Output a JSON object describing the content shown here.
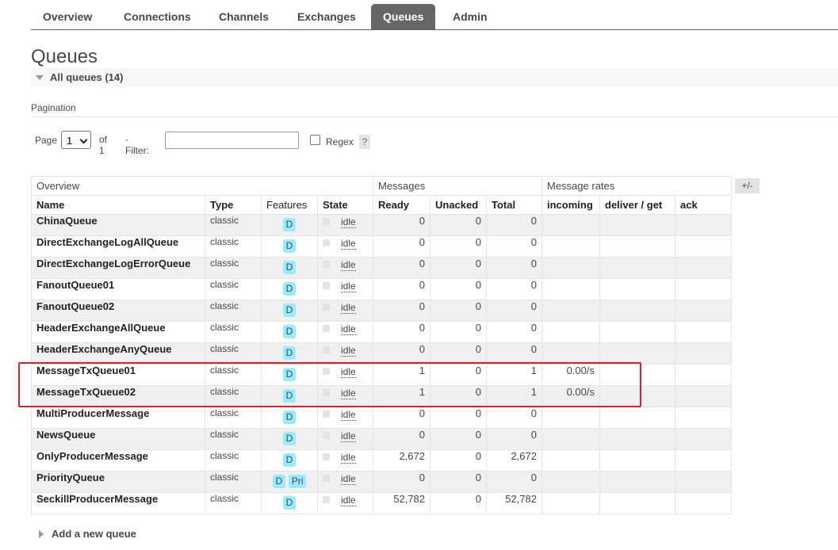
{
  "tabs": [
    "Overview",
    "Connections",
    "Channels",
    "Exchanges",
    "Queues",
    "Admin"
  ],
  "active_tab": "Queues",
  "page_title": "Queues",
  "section": {
    "label": "All queues (14)"
  },
  "pagination": {
    "label": "Pagination",
    "page_label": "Page",
    "page_value": "1",
    "of_label": "of 1",
    "filter_label": "- Filter:",
    "filter_value": "",
    "regex_label": "Regex",
    "help": "?"
  },
  "table": {
    "groups": [
      "Overview",
      "Messages",
      "Message rates"
    ],
    "columns": [
      "Name",
      "Type",
      "Features",
      "State",
      "Ready",
      "Unacked",
      "Total",
      "incoming",
      "deliver / get",
      "ack"
    ],
    "toggle": "+/-",
    "rows": [
      {
        "name": "ChinaQueue",
        "type": "classic",
        "features": [
          "D"
        ],
        "state": "idle",
        "ready": "0",
        "unacked": "0",
        "total": "0",
        "incoming": "",
        "deliver": "",
        "ack": ""
      },
      {
        "name": "DirectExchangeLogAllQueue",
        "type": "classic",
        "features": [
          "D"
        ],
        "state": "idle",
        "ready": "0",
        "unacked": "0",
        "total": "0",
        "incoming": "",
        "deliver": "",
        "ack": ""
      },
      {
        "name": "DirectExchangeLogErrorQueue",
        "type": "classic",
        "features": [
          "D"
        ],
        "state": "idle",
        "ready": "0",
        "unacked": "0",
        "total": "0",
        "incoming": "",
        "deliver": "",
        "ack": ""
      },
      {
        "name": "FanoutQueue01",
        "type": "classic",
        "features": [
          "D"
        ],
        "state": "idle",
        "ready": "0",
        "unacked": "0",
        "total": "0",
        "incoming": "",
        "deliver": "",
        "ack": ""
      },
      {
        "name": "FanoutQueue02",
        "type": "classic",
        "features": [
          "D"
        ],
        "state": "idle",
        "ready": "0",
        "unacked": "0",
        "total": "0",
        "incoming": "",
        "deliver": "",
        "ack": ""
      },
      {
        "name": "HeaderExchangeAllQueue",
        "type": "classic",
        "features": [
          "D"
        ],
        "state": "idle",
        "ready": "0",
        "unacked": "0",
        "total": "0",
        "incoming": "",
        "deliver": "",
        "ack": ""
      },
      {
        "name": "HeaderExchangeAnyQueue",
        "type": "classic",
        "features": [
          "D"
        ],
        "state": "idle",
        "ready": "0",
        "unacked": "0",
        "total": "0",
        "incoming": "",
        "deliver": "",
        "ack": ""
      },
      {
        "name": "MessageTxQueue01",
        "type": "classic",
        "features": [
          "D"
        ],
        "state": "idle",
        "ready": "1",
        "unacked": "0",
        "total": "1",
        "incoming": "0.00/s",
        "deliver": "",
        "ack": ""
      },
      {
        "name": "MessageTxQueue02",
        "type": "classic",
        "features": [
          "D"
        ],
        "state": "idle",
        "ready": "1",
        "unacked": "0",
        "total": "1",
        "incoming": "0.00/s",
        "deliver": "",
        "ack": ""
      },
      {
        "name": "MultiProducerMessage",
        "type": "classic",
        "features": [
          "D"
        ],
        "state": "idle",
        "ready": "0",
        "unacked": "0",
        "total": "0",
        "incoming": "",
        "deliver": "",
        "ack": ""
      },
      {
        "name": "NewsQueue",
        "type": "classic",
        "features": [
          "D"
        ],
        "state": "idle",
        "ready": "0",
        "unacked": "0",
        "total": "0",
        "incoming": "",
        "deliver": "",
        "ack": ""
      },
      {
        "name": "OnlyProducerMessage",
        "type": "classic",
        "features": [
          "D"
        ],
        "state": "idle",
        "ready": "2,672",
        "unacked": "0",
        "total": "2,672",
        "incoming": "",
        "deliver": "",
        "ack": ""
      },
      {
        "name": "PriorityQueue",
        "type": "classic",
        "features": [
          "D",
          "Pri"
        ],
        "state": "idle",
        "ready": "0",
        "unacked": "0",
        "total": "0",
        "incoming": "",
        "deliver": "",
        "ack": ""
      },
      {
        "name": "SeckillProducerMessage",
        "type": "classic",
        "features": [
          "D"
        ],
        "state": "idle",
        "ready": "52,782",
        "unacked": "0",
        "total": "52,782",
        "incoming": "",
        "deliver": "",
        "ack": ""
      }
    ]
  },
  "add_queue": {
    "label": "Add a new queue"
  },
  "colors": {
    "active_tab": "#666666",
    "feature_badge": "#99ebff",
    "highlight": "#e0202b"
  }
}
